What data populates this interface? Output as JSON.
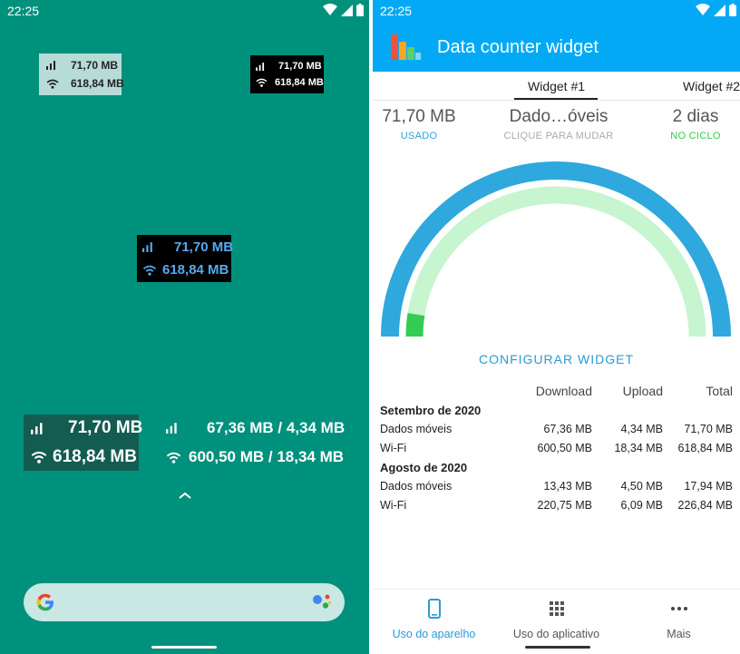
{
  "home": {
    "status_time": "22:25",
    "widgets": [
      {
        "mobile": "71,70 MB",
        "wifi": "618,84 MB"
      },
      {
        "mobile": "71,70 MB",
        "wifi": "618,84 MB"
      },
      {
        "mobile": "71,70 MB",
        "wifi": "618,84 MB"
      },
      {
        "mobile": "71,70 MB",
        "wifi": "618,84 MB"
      },
      {
        "mobile": "67,36 MB / 4,34 MB",
        "wifi": "600,50 MB / 18,34 MB"
      }
    ],
    "icons": [
      "wifi-icon",
      "signal-icon",
      "battery-icon",
      "chevron-up-icon",
      "google-g-icon",
      "assistant-icon"
    ]
  },
  "app": {
    "status_time": "22:25",
    "title": "Data counter widget",
    "tabs": [
      {
        "label": "Widget #1",
        "active": true
      },
      {
        "label": "Widget #2",
        "active": false
      }
    ],
    "stats": {
      "used": {
        "value": "71,70 MB",
        "label": "USADO"
      },
      "source": {
        "value": "Dado…óveis",
        "label": "CLIQUE PARA MUDAR"
      },
      "cycle": {
        "value": "2 dias",
        "label": "NO CICLO"
      }
    },
    "gauge": {
      "outer_fill_fraction": 1.0,
      "inner_used_fraction": 0.05
    },
    "configure_label": "CONFIGURAR WIDGET",
    "table": {
      "headers": [
        "",
        "Download",
        "Upload",
        "Total"
      ],
      "groups": [
        {
          "title": "Setembro de 2020",
          "rows": [
            [
              "Dados móveis",
              "67,36 MB",
              "4,34 MB",
              "71,70 MB"
            ],
            [
              "Wi-Fi",
              "600,50 MB",
              "18,34 MB",
              "618,84 MB"
            ]
          ]
        },
        {
          "title": "Agosto de 2020",
          "rows": [
            [
              "Dados móveis",
              "13,43 MB",
              "4,50 MB",
              "17,94 MB"
            ],
            [
              "Wi-Fi",
              "220,75 MB",
              "6,09 MB",
              "226,84 MB"
            ]
          ]
        }
      ]
    },
    "nav": [
      {
        "label": "Uso do aparelho",
        "icon": "phone-icon",
        "active": true
      },
      {
        "label": "Uso do aplicativo",
        "icon": "grid-icon",
        "active": false
      },
      {
        "label": "Mais",
        "icon": "more-dots-icon",
        "active": false
      }
    ],
    "colors": {
      "primary": "#03a9f4",
      "accent": "#2b9bd3",
      "green": "#33cc44",
      "gauge_inner": "#c6f5d0",
      "home_bg": "#00917c"
    }
  }
}
